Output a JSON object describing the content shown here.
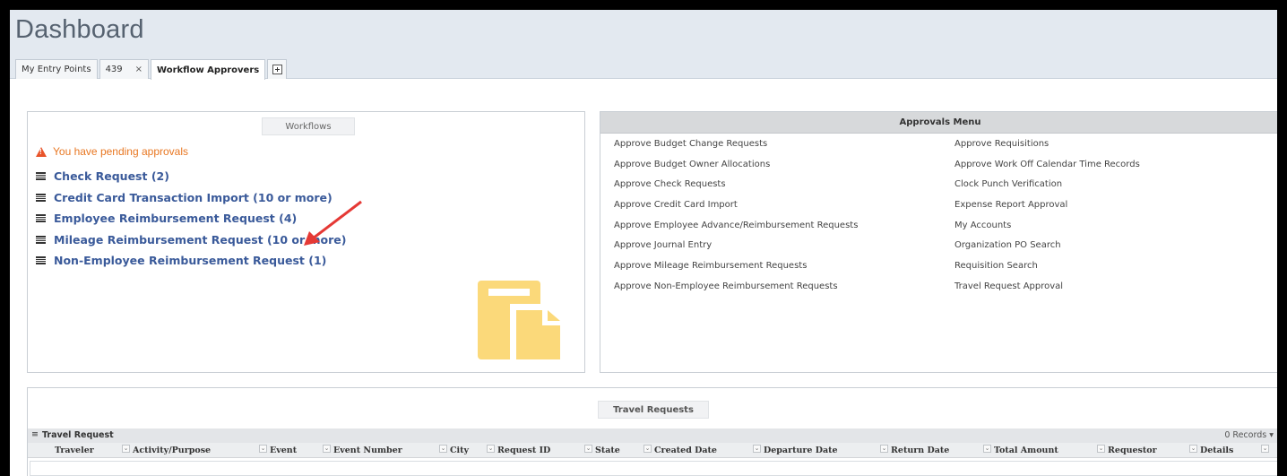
{
  "page": {
    "title": "Dashboard"
  },
  "tabs": [
    {
      "label": "My Entry Points"
    },
    {
      "label": "439",
      "close": "×"
    },
    {
      "label": "Workflow Approvers"
    }
  ],
  "workflows": {
    "title": "Workflows",
    "pending": "You have pending approvals",
    "items": [
      "Check Request (2)",
      "Credit Card Transaction Import (10 or more)",
      "Employee Reimbursement Request (4)",
      "Mileage Reimbursement Request (10 or more)",
      "Non-Employee Reimbursement Request (1)"
    ],
    "highlight_color": "#e53935",
    "icon_color": "#fbd97a"
  },
  "approvals": {
    "title": "Approvals Menu",
    "left": [
      "Approve Budget Change Requests",
      "Approve Budget Owner Allocations",
      "Approve Check Requests",
      "Approve Credit Card Import",
      "Approve Employee Advance/Reimbursement Requests",
      "Approve Journal Entry",
      "Approve Mileage Reimbursement Requests",
      "Approve Non-Employee Reimbursement Requests"
    ],
    "right": [
      "Approve Requisitions",
      "Approve Work Off Calendar Time Records",
      "Clock Punch Verification",
      "Expense Report Approval",
      "My Accounts",
      "Organization PO Search",
      "Requisition Search",
      "Travel Request Approval"
    ]
  },
  "travel": {
    "title": "Travel Requests",
    "grid_title": "Travel Request",
    "records": "0 Records",
    "columns": [
      "Traveler",
      "Activity/Purpose",
      "Event",
      "Event Number",
      "City",
      "Request ID",
      "State",
      "Created Date",
      "Departure Date",
      "Return Date",
      "Total Amount",
      "Requestor",
      "Details"
    ]
  }
}
